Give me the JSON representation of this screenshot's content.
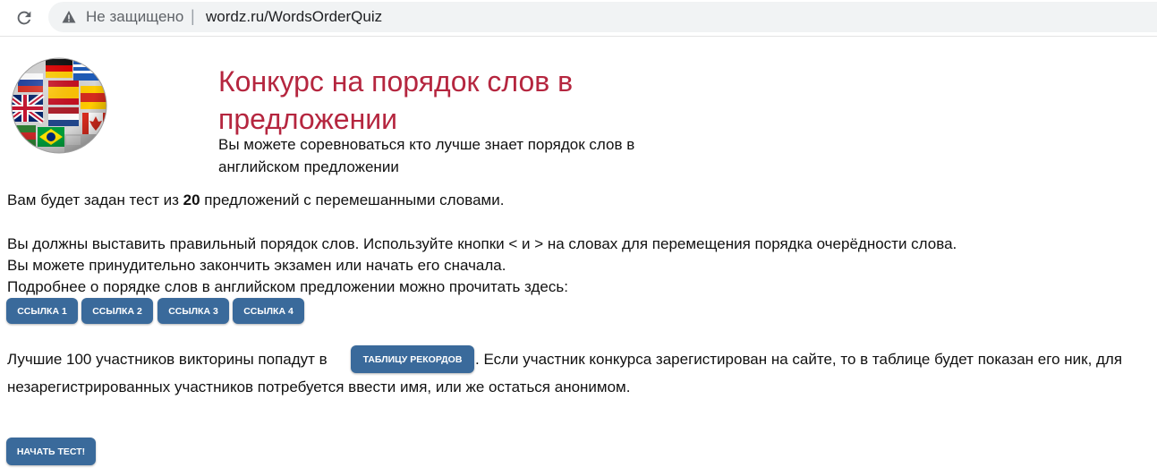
{
  "browser": {
    "security_label": "Не защищено",
    "separator": "|",
    "url": "wordz.ru/WordsOrderQuiz"
  },
  "header": {
    "title": "Конкурс на порядок слов в предложении",
    "subtitle": "Вы можете соревноваться кто лучше знает порядок слов в английском предложении"
  },
  "intro": {
    "test_prefix": "Вам будет задан тест из ",
    "test_count": "20",
    "test_suffix": " предложений с перемешанными словами."
  },
  "instructions": {
    "line1": "Вы должны выставить правильный порядок слов. Используйте кнопки < и > на словах для перемещения порядка очерёдности слова.",
    "line2": "Вы можете принудительно закончить экзамен или начать его сначала.",
    "line3": "Подробнее о порядке слов в английском предложении можно прочитать здесь:"
  },
  "links": [
    {
      "label": "ССЫЛКА 1"
    },
    {
      "label": "ССЫЛКА 2"
    },
    {
      "label": "ССЫЛКА 3"
    },
    {
      "label": "ССЫЛКА 4"
    }
  ],
  "records": {
    "prefix": "Лучшие 100 участников викторины попадут в",
    "button_label": "ТАБЛИЦУ РЕКОРДОВ",
    "suffix": ". Если участник конкурса зарегистирован на сайте, то в таблице будет показан его ник, для",
    "line2": "незарегистрированных участников потребуется ввести имя, или же остаться анонимом."
  },
  "start_button": "НАЧАТЬ ТЕСТ!",
  "colors": {
    "title": "#b5263f",
    "button": "#3a6a9b"
  },
  "icons": {
    "reload": "reload-icon",
    "warning": "warning-icon",
    "logo": "flags-globe-logo"
  }
}
